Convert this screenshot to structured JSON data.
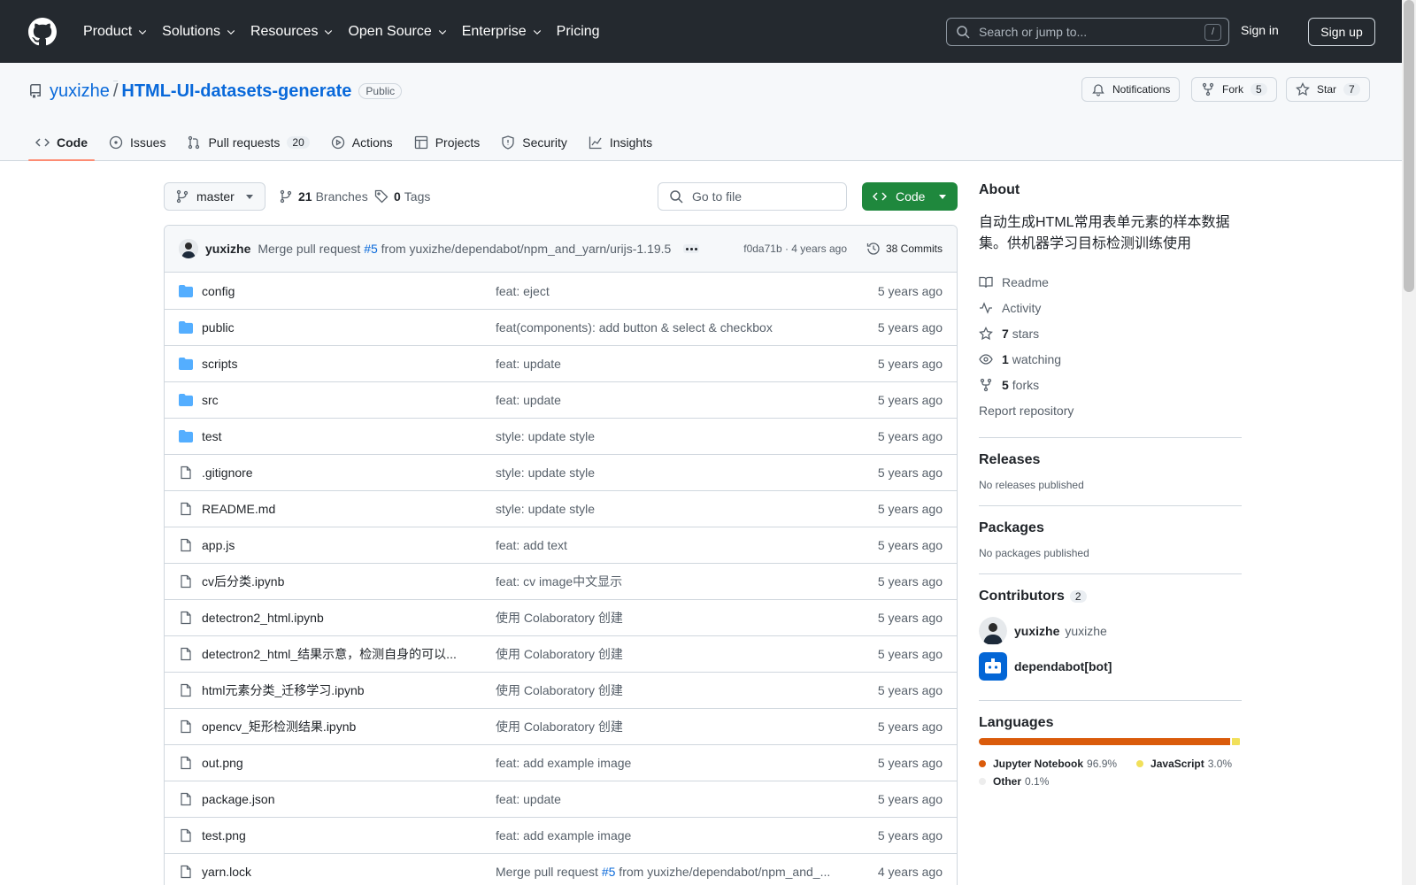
{
  "header": {
    "nav": [
      "Product",
      "Solutions",
      "Resources",
      "Open Source",
      "Enterprise",
      "Pricing"
    ],
    "search_placeholder": "Search or jump to...",
    "search_kbd": "/",
    "signin": "Sign in",
    "signup": "Sign up"
  },
  "repo": {
    "owner": "yuxizhe",
    "sep": "/",
    "name": "HTML-UI-datasets-generate",
    "visibility": "Public",
    "notifications": "Notifications",
    "fork": "Fork",
    "fork_count": "5",
    "star": "Star",
    "star_count": "7"
  },
  "tabs": [
    {
      "label": "Code",
      "count": ""
    },
    {
      "label": "Issues",
      "count": ""
    },
    {
      "label": "Pull requests",
      "count": "20"
    },
    {
      "label": "Actions",
      "count": ""
    },
    {
      "label": "Projects",
      "count": ""
    },
    {
      "label": "Security",
      "count": ""
    },
    {
      "label": "Insights",
      "count": ""
    }
  ],
  "branch": {
    "name": "master",
    "branches_count": "21",
    "branches_label": "Branches",
    "tags_count": "0",
    "tags_label": "Tags",
    "go_to_file": "Go to file",
    "code_button": "Code"
  },
  "latest_commit": {
    "author": "yuxizhe",
    "message_pre": "Merge pull request",
    "pr": "#5",
    "message_post": "from yuxizhe/dependabot/npm_and_yarn/urijs-1.19.5",
    "sha": "f0da71b · 4 years ago",
    "commits": "38 Commits"
  },
  "files": [
    {
      "type": "dir",
      "name": "config",
      "msg": "feat: eject",
      "age": "5 years ago"
    },
    {
      "type": "dir",
      "name": "public",
      "msg": "feat(components): add button & select & checkbox",
      "age": "5 years ago"
    },
    {
      "type": "dir",
      "name": "scripts",
      "msg": "feat: update",
      "age": "5 years ago"
    },
    {
      "type": "dir",
      "name": "src",
      "msg": "feat: update",
      "age": "5 years ago"
    },
    {
      "type": "dir",
      "name": "test",
      "msg": "style: update style",
      "age": "5 years ago"
    },
    {
      "type": "file",
      "name": ".gitignore",
      "msg": "style: update style",
      "age": "5 years ago"
    },
    {
      "type": "file",
      "name": "README.md",
      "msg": "style: update style",
      "age": "5 years ago"
    },
    {
      "type": "file",
      "name": "app.js",
      "msg": "feat: add text",
      "age": "5 years ago"
    },
    {
      "type": "file",
      "name": "cv后分类.ipynb",
      "msg": "feat: cv image中文显示",
      "age": "5 years ago"
    },
    {
      "type": "file",
      "name": "detectron2_html.ipynb",
      "msg": "使用 Colaboratory 创建",
      "age": "5 years ago"
    },
    {
      "type": "file",
      "name": "detectron2_html_结果示意，检测自身的可以...",
      "msg": "使用 Colaboratory 创建",
      "age": "5 years ago"
    },
    {
      "type": "file",
      "name": "html元素分类_迁移学习.ipynb",
      "msg": "使用 Colaboratory 创建",
      "age": "5 years ago"
    },
    {
      "type": "file",
      "name": "opencv_矩形检测结果.ipynb",
      "msg": "使用 Colaboratory 创建",
      "age": "5 years ago"
    },
    {
      "type": "file",
      "name": "out.png",
      "msg": "feat: add example image",
      "age": "5 years ago"
    },
    {
      "type": "file",
      "name": "package.json",
      "msg": "feat: update",
      "age": "5 years ago"
    },
    {
      "type": "file",
      "name": "test.png",
      "msg": "feat: add example image",
      "age": "5 years ago"
    },
    {
      "type": "file",
      "name": "yarn.lock",
      "msg_pre": "Merge pull request ",
      "msg_link": "#5",
      "msg": " from yuxizhe/dependabot/npm_and_...",
      "age": "4 years ago"
    }
  ],
  "about": {
    "heading": "About",
    "description": "自动生成HTML常用表单元素的样本数据集。供机器学习目标检测训练使用",
    "readme": "Readme",
    "activity": "Activity",
    "stars_n": "7",
    "stars": "stars",
    "watching_n": "1",
    "watching": "watching",
    "forks_n": "5",
    "forks": "forks",
    "report": "Report repository"
  },
  "releases": {
    "heading": "Releases",
    "text": "No releases published"
  },
  "packages": {
    "heading": "Packages",
    "text": "No packages published"
  },
  "contributors": {
    "heading": "Contributors",
    "count": "2",
    "list": [
      {
        "login": "yuxizhe",
        "name": "yuxizhe"
      },
      {
        "login": "dependabot[bot]",
        "name": ""
      }
    ]
  },
  "languages": {
    "heading": "Languages",
    "items": [
      {
        "name": "Jupyter Notebook",
        "pct": "96.9%",
        "value": 96.9,
        "color": "#DA5B0B"
      },
      {
        "name": "JavaScript",
        "pct": "3.0%",
        "value": 3.0,
        "color": "#f1e05a"
      },
      {
        "name": "Other",
        "pct": "0.1%",
        "value": 0.1,
        "color": "#ededed"
      }
    ]
  }
}
